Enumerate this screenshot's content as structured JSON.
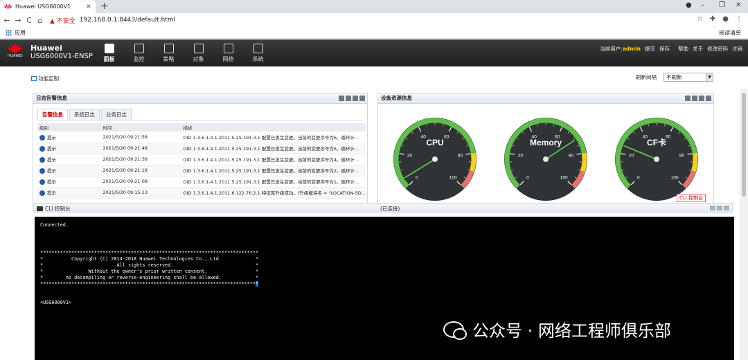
{
  "browser": {
    "tab_title": "Huawei USG6000V1",
    "tab_close": "×",
    "new_tab": "+",
    "win_min": "–",
    "win_max": "❐",
    "win_close": "✕",
    "back": "←",
    "forward": "→",
    "reload": "C",
    "home": "⌂",
    "security_warning": "▲ 不安全",
    "url": "192.168.0.1:8443/default.html",
    "apps_label": "应用",
    "reading_list": "阅读清单"
  },
  "header": {
    "logo_text": "HUAWEI",
    "brand_line1": "Huawei",
    "brand_line2": "USG6000V1-ENSP",
    "nav": [
      {
        "label": "面板",
        "active": true
      },
      {
        "label": "监控",
        "active": false
      },
      {
        "label": "策略",
        "active": false
      },
      {
        "label": "对象",
        "active": false
      },
      {
        "label": "网络",
        "active": false
      },
      {
        "label": "系统",
        "active": false
      }
    ],
    "current_user_label": "当前用户:",
    "current_user": "admin",
    "links": [
      "提交",
      "保存",
      "帮助",
      "关于",
      "修改密码",
      "注销"
    ]
  },
  "toolbar": {
    "customize": "功能定制",
    "refresh_label": "刷新间隔",
    "refresh_value": "不刷新"
  },
  "log_panel": {
    "title": "日志告警信息",
    "tabs": [
      "告警信息",
      "系统日志",
      "业务日志"
    ],
    "columns": [
      "级别",
      "时间",
      "描述"
    ],
    "rows": [
      {
        "level": "提示",
        "time": "2021/5/20 09:21:58",
        "desc": "OID 1.3.6.1.4.1.2011.5.25.191.3.1 配置已发生变更。当前的变更序号为6。循环计..."
      },
      {
        "level": "提示",
        "time": "2021/5/20 09:21:48",
        "desc": "OID 1.3.6.1.4.1.2011.5.25.191.3.1 配置已发生变更。当前的变更序号为5。循环计..."
      },
      {
        "level": "提示",
        "time": "2021/5/20 09:21:38",
        "desc": "OID 1.3.6.1.4.1.2011.5.25.191.3.1 配置已发生变更。当前的变更序号为4。循环计..."
      },
      {
        "level": "提示",
        "time": "2021/5/20 09:21:18",
        "desc": "OID 1.3.6.1.4.1.2011.5.25.191.3.1 配置已发生变更。当前的变更序号为2。循环计..."
      },
      {
        "level": "提示",
        "time": "2021/5/20 09:21:08",
        "desc": "OID 1.3.6.1.4.1.2011.5.25.191.3.1 配置已发生变更。当前的变更序号为1。循环计..."
      },
      {
        "level": "提示",
        "time": "2021/5/20 09:15:13",
        "desc": "OID 1.3.6.1.4.1.2011.6.122.76.2.1 特征库升级成功。(升级模块名 = \"LOCATION-SD..."
      }
    ]
  },
  "resource_panel": {
    "title": "设备资源信息",
    "gauges": [
      {
        "label": "CPU",
        "value": 5
      },
      {
        "label": "Memory",
        "value": 71
      },
      {
        "label": "CF卡",
        "value": 25
      }
    ],
    "ticks": [
      "0",
      "20",
      "40",
      "60",
      "80",
      "100"
    ]
  },
  "cli": {
    "badge": "CLI 控制台",
    "title": "CLI 控制台",
    "status": "(已连接)",
    "lines": [
      "Connected.",
      "*****************************************************************************",
      "*          Copyright (C) 2014-2018 Huawei Technologies Co., Ltd.            *",
      "*                          All rights reserved.                             *",
      "*                Without the owner's prior written consent,                 *",
      "*        no decompiling or reverse-engineering shall be allowed.            *",
      "*****************************************************************************",
      "<USG6000V1>"
    ]
  },
  "watermark": "公众号 · 网络工程师俱乐部",
  "colors": {
    "header_bg": "#2b2b2b",
    "accent_red": "#e60012",
    "user_yellow": "#ffd200",
    "gauge_green": "#5fbf4a",
    "gauge_yellow": "#f2d21b",
    "gauge_red": "#e8736b"
  }
}
